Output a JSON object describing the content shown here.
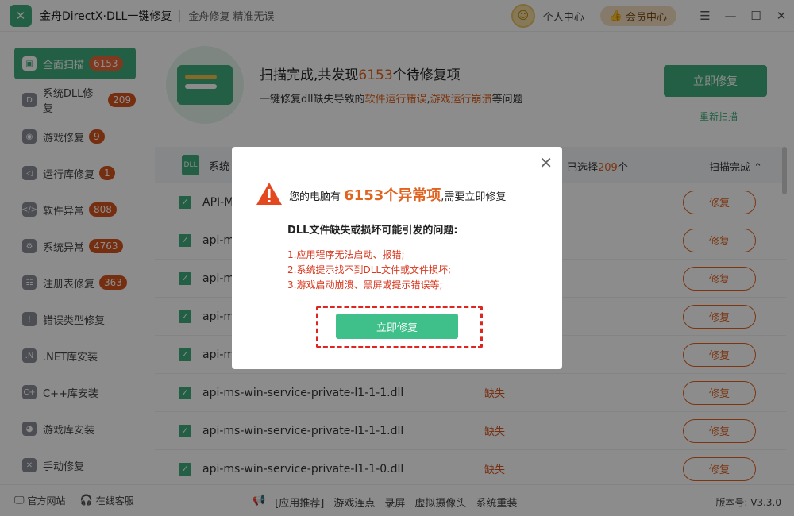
{
  "titlebar": {
    "app_title": "金舟DirectX·DLL一键修复",
    "slogan": "金舟修复 精准无误",
    "user_center": "个人中心",
    "vip_center": "会员中心"
  },
  "sidebar": {
    "items": [
      {
        "label": "全面扫描",
        "badge": "6153",
        "icon": "scan-icon"
      },
      {
        "label": "系统DLL修复",
        "badge": "209",
        "icon": "dll-icon"
      },
      {
        "label": "游戏修复",
        "badge": "9",
        "icon": "gamepad-icon"
      },
      {
        "label": "运行库修复",
        "badge": "1",
        "icon": "runtime-icon"
      },
      {
        "label": "软件异常",
        "badge": "808",
        "icon": "code-icon"
      },
      {
        "label": "系统异常",
        "badge": "4763",
        "icon": "gear-icon"
      },
      {
        "label": "注册表修复",
        "badge": "363",
        "icon": "registry-icon"
      },
      {
        "label": "错误类型修复",
        "badge": "",
        "icon": "warning-icon"
      },
      {
        "label": ".NET库安装",
        "badge": "",
        "icon": "dotnet-icon"
      },
      {
        "label": "C++库安装",
        "badge": "",
        "icon": "cpp-icon"
      },
      {
        "label": "游戏库安装",
        "badge": "",
        "icon": "pacman-icon"
      },
      {
        "label": "手动修复",
        "badge": "",
        "icon": "wrench-icon"
      }
    ]
  },
  "hero": {
    "title_prefix": "扫描完成,共发现",
    "title_count": "6153",
    "title_suffix": "个待修复项",
    "sub_prefix": "一键修复dll缺失导致的",
    "sub_hl1": "软件运行错误",
    "sub_sep": ",",
    "sub_hl2": "游戏运行崩溃",
    "sub_suffix": "等问题",
    "fix_button": "立即修复",
    "rescan": "重新扫描"
  },
  "list": {
    "header_label": "系统",
    "selected_prefix": "已选择",
    "selected_count": "209",
    "selected_suffix": "个",
    "status": "扫描完成",
    "fix_label": "修复",
    "rows": [
      {
        "name": "API-M",
        "status": ""
      },
      {
        "name": "api-m",
        "status": ""
      },
      {
        "name": "api-m",
        "status": ""
      },
      {
        "name": "api-m",
        "status": ""
      },
      {
        "name": "api-m",
        "status": ""
      },
      {
        "name": "api-ms-win-service-private-l1-1-1.dll",
        "status": "缺失"
      },
      {
        "name": "api-ms-win-service-private-l1-1-1.dll",
        "status": "缺失"
      },
      {
        "name": "api-ms-win-service-private-l1-1-0.dll",
        "status": "缺失"
      }
    ]
  },
  "footer": {
    "website": "官方网站",
    "support": "在线客服",
    "links": [
      "[应用推荐]",
      "游戏连点",
      "录屏",
      "虚拟摄像头",
      "系统重装"
    ],
    "version": "版本号: V3.3.0"
  },
  "modal": {
    "title_prefix": "您的电脑有",
    "title_count": "6153个异常项",
    "title_suffix": ",需要立即修复",
    "subtitle": "DLL文件缺失或损坏可能引发的问题:",
    "issues": [
      "1.应用程序无法启动、报错;",
      "2.系统提示找不到DLL文件或文件损坏;",
      "3.游戏启动崩溃、黑屏或提示错误等;"
    ],
    "button": "立即修复"
  },
  "colors": {
    "accent": "#3fae7c",
    "warning": "#e06320",
    "error": "#d8381f"
  }
}
